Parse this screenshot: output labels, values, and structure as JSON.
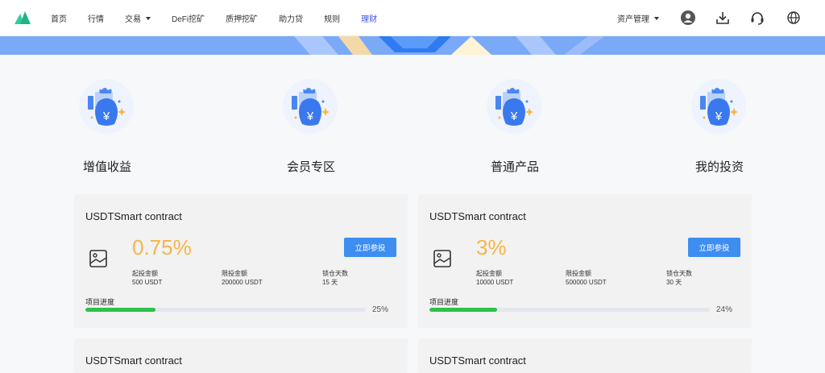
{
  "nav": {
    "items": [
      {
        "label": "首页"
      },
      {
        "label": "行情"
      },
      {
        "label": "交易",
        "has_dropdown": true
      },
      {
        "label": "DeFi挖矿"
      },
      {
        "label": "质押挖矿"
      },
      {
        "label": "助力贷"
      },
      {
        "label": "规则"
      },
      {
        "label": "理财",
        "active": true
      }
    ],
    "asset_menu": "资产管理",
    "icons": [
      "user-avatar-icon",
      "download-icon",
      "headset-icon",
      "globe-icon"
    ]
  },
  "colors": {
    "accent": "#3b4fe0",
    "banner": "#7aa9f8",
    "rate": "#f7b547",
    "button": "#3d8ef0",
    "progress": "#2dc14b"
  },
  "categories": [
    {
      "label": "增值收益",
      "icon": "money-bag-icon"
    },
    {
      "label": "会员专区",
      "icon": "money-bag-icon"
    },
    {
      "label": "普通产品",
      "icon": "money-bag-icon"
    },
    {
      "label": "我的投资",
      "icon": "money-bag-icon"
    }
  ],
  "products": [
    {
      "title": "USDTSmart contract",
      "rate": "0.75%",
      "button": "立即参投",
      "min_label": "起投金额",
      "min_value": "500 USDT",
      "max_label": "限投金额",
      "max_value": "200000 USDT",
      "lock_label": "锁仓天数",
      "lock_value": "15 天",
      "progress_label": "项目进度",
      "progress": 25,
      "progress_text": "25%"
    },
    {
      "title": "USDTSmart contract",
      "rate": "3%",
      "button": "立即参投",
      "min_label": "起投金额",
      "min_value": "10000 USDT",
      "max_label": "限投金额",
      "max_value": "500000 USDT",
      "lock_label": "锁仓天数",
      "lock_value": "30 天",
      "progress_label": "项目进度",
      "progress": 24,
      "progress_text": "24%"
    },
    {
      "title": "USDTSmart contract"
    },
    {
      "title": "USDTSmart contract"
    }
  ]
}
